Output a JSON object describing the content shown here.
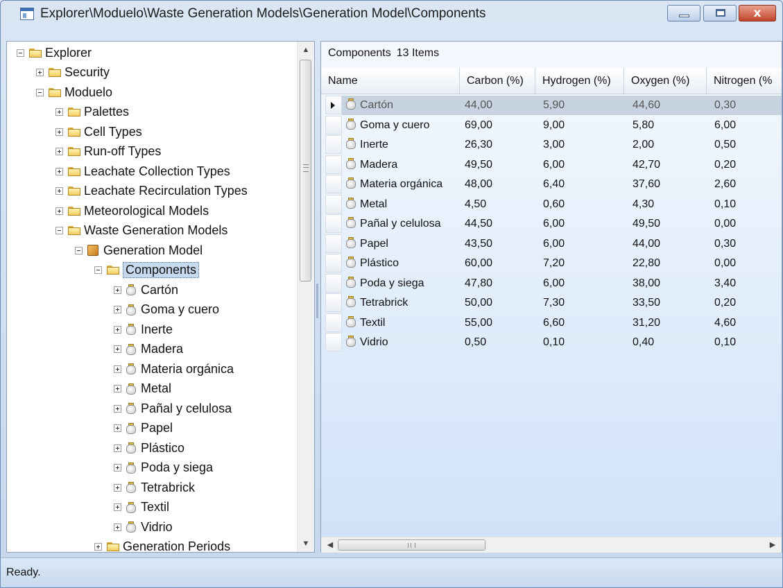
{
  "window": {
    "title": "Explorer\\Moduelo\\Waste Generation Models\\Generation Model\\Components",
    "close_glyph": "x"
  },
  "tree": {
    "items": [
      {
        "label": "Explorer",
        "icon": "folder-icon",
        "expander": "minus",
        "selected": false
      },
      {
        "label": "Security",
        "icon": "folder-icon",
        "expander": "plus",
        "selected": false
      },
      {
        "label": "Moduelo",
        "icon": "folder-icon",
        "expander": "minus",
        "selected": false
      },
      {
        "label": "Palettes",
        "icon": "folder-icon",
        "expander": "plus",
        "selected": false
      },
      {
        "label": "Cell Types",
        "icon": "folder-icon",
        "expander": "plus",
        "selected": false
      },
      {
        "label": "Run-off Types",
        "icon": "folder-icon",
        "expander": "plus",
        "selected": false
      },
      {
        "label": "Leachate Collection Types",
        "icon": "folder-icon",
        "expander": "plus",
        "selected": false
      },
      {
        "label": "Leachate Recirculation Types",
        "icon": "folder-icon",
        "expander": "plus",
        "selected": false
      },
      {
        "label": "Meteorological Models",
        "icon": "folder-icon",
        "expander": "plus",
        "selected": false
      },
      {
        "label": "Waste Generation Models",
        "icon": "folder-icon",
        "expander": "minus",
        "selected": false
      },
      {
        "label": "Generation Model",
        "icon": "model-icon",
        "expander": "minus",
        "selected": false
      },
      {
        "label": "Components",
        "icon": "folder-icon",
        "expander": "minus",
        "selected": true
      },
      {
        "label": "Cartón",
        "icon": "jar-icon",
        "expander": "plus",
        "selected": false
      },
      {
        "label": "Goma y cuero",
        "icon": "jar-icon",
        "expander": "plus",
        "selected": false
      },
      {
        "label": "Inerte",
        "icon": "jar-icon",
        "expander": "plus",
        "selected": false
      },
      {
        "label": "Madera",
        "icon": "jar-icon",
        "expander": "plus",
        "selected": false
      },
      {
        "label": "Materia orgánica",
        "icon": "jar-icon",
        "expander": "plus",
        "selected": false
      },
      {
        "label": "Metal",
        "icon": "jar-icon",
        "expander": "plus",
        "selected": false
      },
      {
        "label": "Pañal y celulosa",
        "icon": "jar-icon",
        "expander": "plus",
        "selected": false
      },
      {
        "label": "Papel",
        "icon": "jar-icon",
        "expander": "plus",
        "selected": false
      },
      {
        "label": "Plástico",
        "icon": "jar-icon",
        "expander": "plus",
        "selected": false
      },
      {
        "label": "Poda y siega",
        "icon": "jar-icon",
        "expander": "plus",
        "selected": false
      },
      {
        "label": "Tetrabrick",
        "icon": "jar-icon",
        "expander": "plus",
        "selected": false
      },
      {
        "label": "Textil",
        "icon": "jar-icon",
        "expander": "plus",
        "selected": false
      },
      {
        "label": "Vidrio",
        "icon": "jar-icon",
        "expander": "plus",
        "selected": false
      },
      {
        "label": "Generation Periods",
        "icon": "folder-icon",
        "expander": "plus",
        "selected": false
      }
    ],
    "scroll_up": "▲",
    "scroll_down": "▼"
  },
  "list": {
    "caption": "Components",
    "count": "13 Items",
    "columns": [
      "Name",
      "Carbon (%)",
      "Hydrogen (%)",
      "Oxygen (%)",
      "Nitrogen (%"
    ],
    "rows": [
      {
        "name": "Cartón",
        "carbon": "44,00",
        "hydrogen": "5,90",
        "oxygen": "44,60",
        "nitrogen": "0,30",
        "selected": true
      },
      {
        "name": "Goma y cuero",
        "carbon": "69,00",
        "hydrogen": "9,00",
        "oxygen": "5,80",
        "nitrogen": "6,00",
        "selected": false
      },
      {
        "name": "Inerte",
        "carbon": "26,30",
        "hydrogen": "3,00",
        "oxygen": "2,00",
        "nitrogen": "0,50",
        "selected": false
      },
      {
        "name": "Madera",
        "carbon": "49,50",
        "hydrogen": "6,00",
        "oxygen": "42,70",
        "nitrogen": "0,20",
        "selected": false
      },
      {
        "name": "Materia orgánica",
        "carbon": "48,00",
        "hydrogen": "6,40",
        "oxygen": "37,60",
        "nitrogen": "2,60",
        "selected": false
      },
      {
        "name": "Metal",
        "carbon": "4,50",
        "hydrogen": "0,60",
        "oxygen": "4,30",
        "nitrogen": "0,10",
        "selected": false
      },
      {
        "name": "Pañal y celulosa",
        "carbon": "44,50",
        "hydrogen": "6,00",
        "oxygen": "49,50",
        "nitrogen": "0,00",
        "selected": false
      },
      {
        "name": "Papel",
        "carbon": "43,50",
        "hydrogen": "6,00",
        "oxygen": "44,00",
        "nitrogen": "0,30",
        "selected": false
      },
      {
        "name": "Plástico",
        "carbon": "60,00",
        "hydrogen": "7,20",
        "oxygen": "22,80",
        "nitrogen": "0,00",
        "selected": false
      },
      {
        "name": "Poda y siega",
        "carbon": "47,80",
        "hydrogen": "6,00",
        "oxygen": "38,00",
        "nitrogen": "3,40",
        "selected": false
      },
      {
        "name": "Tetrabrick",
        "carbon": "50,00",
        "hydrogen": "7,30",
        "oxygen": "33,50",
        "nitrogen": "0,20",
        "selected": false
      },
      {
        "name": "Textil",
        "carbon": "55,00",
        "hydrogen": "6,60",
        "oxygen": "31,20",
        "nitrogen": "4,60",
        "selected": false
      },
      {
        "name": "Vidrio",
        "carbon": "0,50",
        "hydrogen": "0,10",
        "oxygen": "0,40",
        "nitrogen": "0,10",
        "selected": false
      }
    ],
    "scroll_left": "◀",
    "scroll_right": "▶"
  },
  "status": {
    "text": "Ready."
  }
}
